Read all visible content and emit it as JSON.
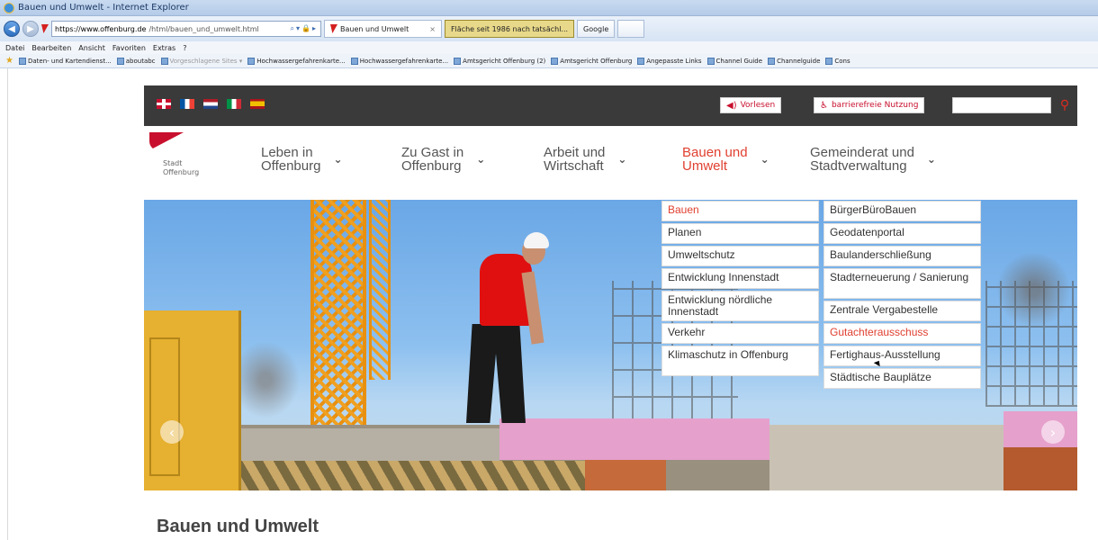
{
  "browser": {
    "window_title": "Bauen und Umwelt - Internet Explorer",
    "address_host": "https://www.offenburg.de",
    "address_path": "/html/bauen_und_umwelt.html",
    "tabs": [
      {
        "label": "Bauen und Umwelt",
        "active": true
      },
      {
        "label": "Fläche seit 1986 nach tatsächl...",
        "highlight": true
      },
      {
        "label": "Google"
      }
    ],
    "menu": [
      "Datei",
      "Bearbeiten",
      "Ansicht",
      "Favoriten",
      "Extras",
      "?"
    ],
    "favorites": [
      "Daten- und Kartendienst...",
      "aboutabc",
      "Vorgeschlagene Sites ▾",
      "Hochwassergefahrenkarte...",
      "Hochwassergefahrenkarte...",
      "Amtsgericht Offenburg (2)",
      "Amtsgericht Offenburg",
      "Angepasste Links",
      "Channel Guide",
      "Channelguide",
      "Cons"
    ]
  },
  "site": {
    "accent_color": "#e04030",
    "top_bar": {
      "languages": [
        "English",
        "Français",
        "Nederlands",
        "Italiano",
        "Español"
      ],
      "read_aloud": "Vorlesen",
      "accessible": "barrierefreie Nutzung",
      "search_placeholder": ""
    },
    "logo": {
      "line1": "Stadt",
      "line2": "Offenburg"
    },
    "nav": [
      {
        "line1": "Leben in",
        "line2": "Offenburg"
      },
      {
        "line1": "Zu Gast in",
        "line2": "Offenburg"
      },
      {
        "line1": "Arbeit und",
        "line2": "Wirtschaft"
      },
      {
        "line1": "Bauen und",
        "line2": "Umwelt",
        "active": true
      },
      {
        "line1": "Gemeinderat und",
        "line2": "Stadtverwaltung"
      }
    ],
    "dropdown_col1": [
      {
        "label": "Bauen",
        "active": true
      },
      {
        "label": "Planen"
      },
      {
        "label": "Umweltschutz"
      },
      {
        "label": "Entwicklung Innenstadt"
      },
      {
        "label": "Entwicklung nördliche Innenstadt"
      },
      {
        "label": "Verkehr"
      },
      {
        "label": "Klimaschutz in Offenburg"
      }
    ],
    "dropdown_col2": [
      {
        "label": "BürgerBüroBauen"
      },
      {
        "label": "Geodatenportal"
      },
      {
        "label": "Baulanderschließung"
      },
      {
        "label": "Stadterneuerung / Sanierung"
      },
      {
        "label": "Zentrale Vergabestelle"
      },
      {
        "label": "Gutachterausschuss",
        "active": true
      },
      {
        "label": "Fertighaus-Ausstellung"
      },
      {
        "label": "Städtische Bauplätze"
      }
    ],
    "page_heading": "Bauen und Umwelt"
  }
}
